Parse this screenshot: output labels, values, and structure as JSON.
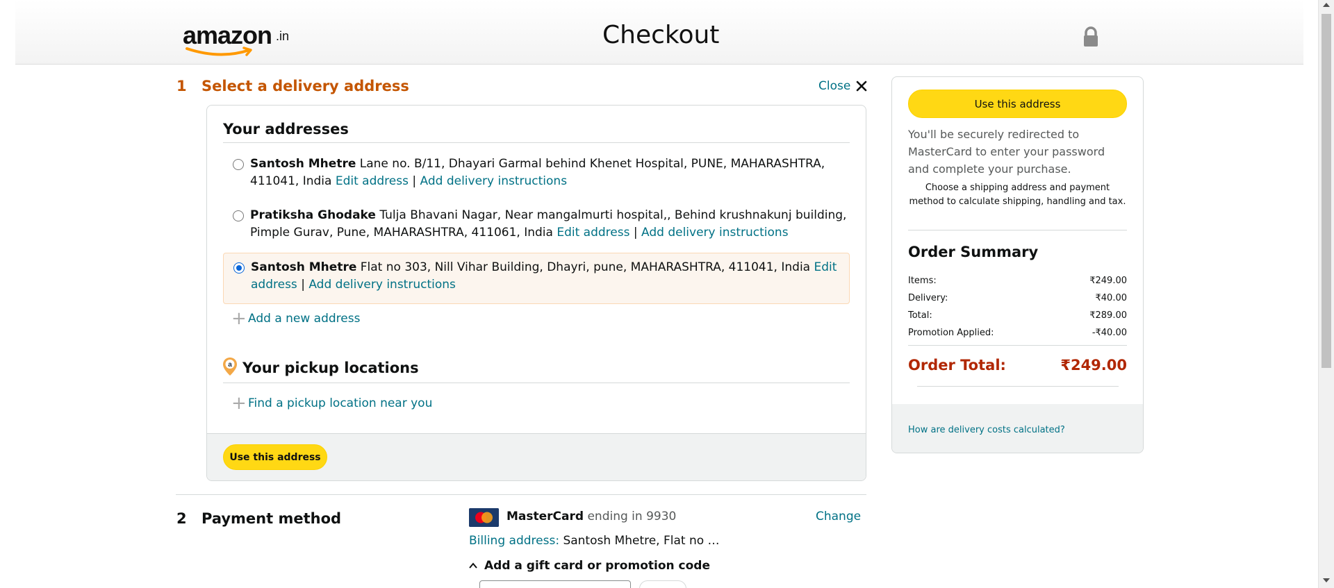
{
  "header": {
    "logo_text": "amazon",
    "logo_suffix": ".in",
    "title": "Checkout"
  },
  "step1": {
    "number": "1",
    "title": "Select a delivery address",
    "close_label": "Close",
    "your_addresses_heading": "Your addresses",
    "addresses": [
      {
        "name": "Santosh Mhetre",
        "address": "Lane no. B/11, Dhayari Garmal behind Khenet Hospital, PUNE, MAHARASHTRA, 411041, India",
        "edit_label": "Edit address",
        "instructions_label": "Add delivery instructions",
        "selected": false
      },
      {
        "name": "Pratiksha Ghodake",
        "address": "Tulja Bhavani Nagar, Near mangalmurti hospital,, Behind krushnakunj building, Pimple Gurav, Pune, MAHARASHTRA, 411061, India",
        "edit_label": "Edit address",
        "instructions_label": "Add delivery instructions",
        "selected": false
      },
      {
        "name": "Santosh Mhetre",
        "address": "Flat no 303, Nill Vihar Building, Dhayri, pune, MAHARASHTRA, 411041, India",
        "edit_label": "Edit address",
        "instructions_label": "Add delivery instructions",
        "selected": true
      }
    ],
    "separator": "|",
    "add_new_address": "Add a new address",
    "pickup_heading": "Your pickup locations",
    "find_pickup": "Find a pickup location near you",
    "use_address_button": "Use this address"
  },
  "step2": {
    "number": "2",
    "title": "Payment method",
    "card_brand": "MasterCard",
    "card_ending_label": "ending in",
    "card_last4": "9930",
    "change_label": "Change",
    "billing_label": "Billing address:",
    "billing_value": "Santosh Mhetre, Flat no …",
    "gift_label": "Add a gift card or promotion code"
  },
  "summary": {
    "use_address_button": "Use this address",
    "redirect_note": "You'll be securely redirected to MasterCard to enter your password and complete your purchase.",
    "shipping_note": "Choose a shipping address and payment method to calculate shipping, handling and tax.",
    "heading": "Order Summary",
    "items_label": "Items:",
    "items_value": "₹249.00",
    "delivery_label": "Delivery:",
    "delivery_value": "₹40.00",
    "total_label": "Total:",
    "total_value": "₹289.00",
    "promo_label": "Promotion Applied:",
    "promo_value": "-₹40.00",
    "order_total_label": "Order Total:",
    "order_total_value": "₹249.00",
    "delivery_cost_link": "How are delivery costs calculated?"
  },
  "icons": {
    "lock": "lock-icon",
    "close": "close-icon",
    "plus": "plus-icon",
    "pickup": "amazon-pin-icon",
    "mastercard": "mastercard-logo-icon",
    "chevron": "chevron-up-icon"
  },
  "colors": {
    "accent_orange": "#C45500",
    "link": "#007185",
    "button_yellow": "#FFD814",
    "price_red": "#B12704",
    "selected_bg": "#FCF5EE"
  }
}
